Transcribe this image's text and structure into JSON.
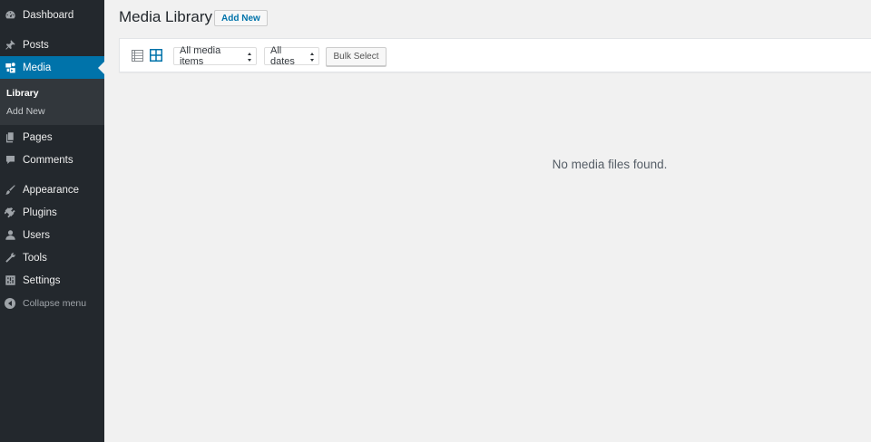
{
  "sidebar": {
    "items": [
      {
        "label": "Dashboard",
        "icon": "dashboard-icon"
      },
      {
        "label": "Posts",
        "icon": "pushpin-icon"
      },
      {
        "label": "Media",
        "icon": "media-icon",
        "active": true
      },
      {
        "label": "Pages",
        "icon": "pages-icon"
      },
      {
        "label": "Comments",
        "icon": "comment-icon"
      },
      {
        "label": "Appearance",
        "icon": "paintbrush-icon"
      },
      {
        "label": "Plugins",
        "icon": "plugin-icon"
      },
      {
        "label": "Users",
        "icon": "user-icon"
      },
      {
        "label": "Tools",
        "icon": "wrench-icon"
      },
      {
        "label": "Settings",
        "icon": "settings-icon"
      }
    ],
    "submenu": [
      {
        "label": "Library",
        "current": true
      },
      {
        "label": "Add New"
      }
    ],
    "collapse_label": "Collapse menu"
  },
  "header": {
    "title": "Media Library",
    "add_new_label": "Add New"
  },
  "toolbar": {
    "type_filter": "All media items",
    "date_filter": "All dates",
    "bulk_select_label": "Bulk Select"
  },
  "main": {
    "empty_message": "No media files found."
  },
  "colors": {
    "sidebar_bg": "#23282d",
    "submenu_bg": "#32373c",
    "accent": "#0073aa",
    "page_bg": "#f1f1f1"
  }
}
